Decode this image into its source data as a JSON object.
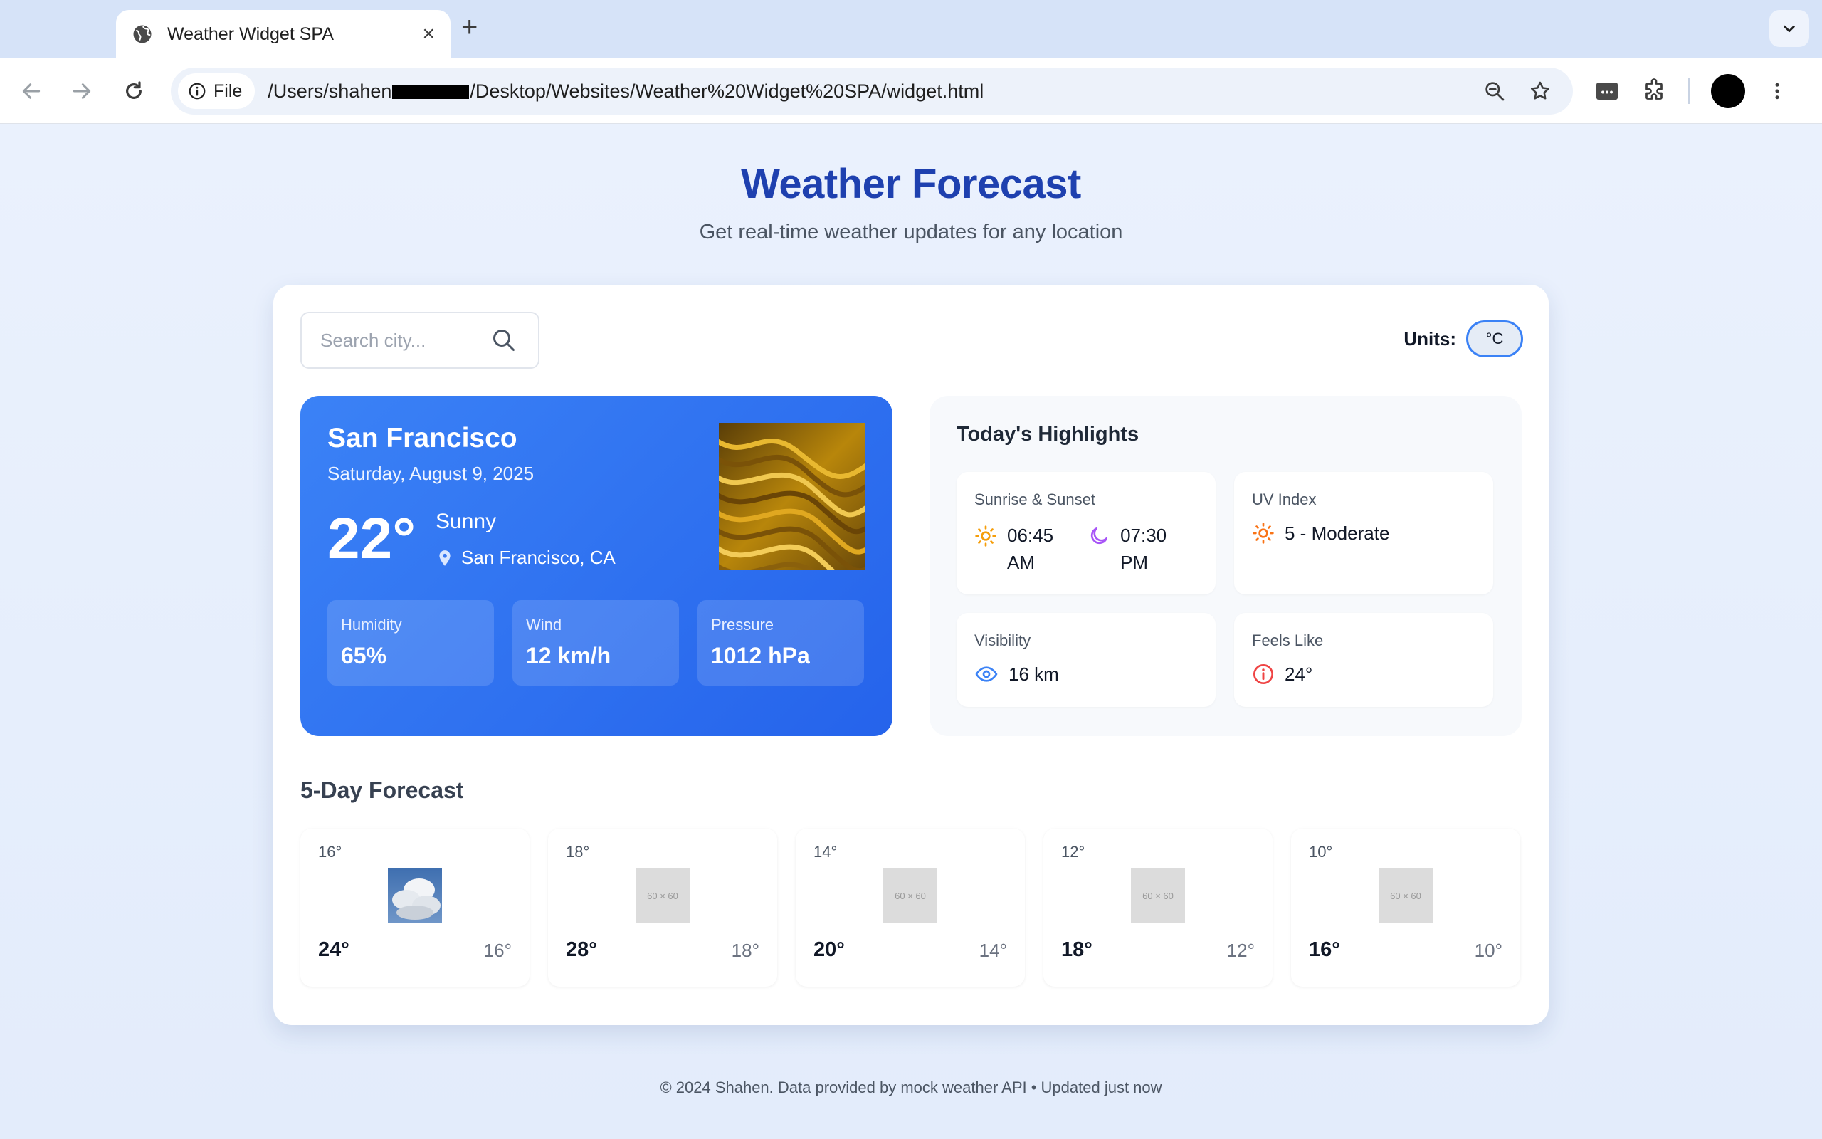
{
  "browser": {
    "tab_title": "Weather Widget SPA",
    "new_tab": "+",
    "close": "×",
    "file_chip": "File",
    "url_prefix": "/Users/shahen",
    "url_suffix": "/Desktop/Websites/Weather%20Widget%20SPA/widget.html"
  },
  "header": {
    "title": "Weather Forecast",
    "subtitle": "Get real-time weather updates for any location"
  },
  "search": {
    "placeholder": "Search city..."
  },
  "units": {
    "label": "Units:",
    "value": "°C"
  },
  "current": {
    "city": "San Francisco",
    "date": "Saturday, August 9, 2025",
    "temp": "22°",
    "condition": "Sunny",
    "location": "San Francisco, CA",
    "stats": [
      {
        "label": "Humidity",
        "value": "65%"
      },
      {
        "label": "Wind",
        "value": "12 km/h"
      },
      {
        "label": "Pressure",
        "value": "1012 hPa"
      }
    ]
  },
  "highlights": {
    "title": "Today's Highlights",
    "sunrise_sunset": {
      "label": "Sunrise & Sunset",
      "sunrise": "06:45",
      "sunrise_period": "AM",
      "sunset": "07:30",
      "sunset_period": "PM"
    },
    "uv": {
      "label": "UV Index",
      "value": "5 - Moderate"
    },
    "visibility": {
      "label": "Visibility",
      "value": "16 km"
    },
    "feels_like": {
      "label": "Feels Like",
      "value": "24°"
    }
  },
  "forecast": {
    "title": "5-Day Forecast",
    "days": [
      {
        "top": "16°",
        "high": "24°",
        "low": "16°",
        "image": "cloudy-sky"
      },
      {
        "top": "18°",
        "high": "28°",
        "low": "18°",
        "image": "placeholder",
        "placeholder_text": "60 × 60"
      },
      {
        "top": "14°",
        "high": "20°",
        "low": "14°",
        "image": "placeholder",
        "placeholder_text": "60 × 60"
      },
      {
        "top": "12°",
        "high": "18°",
        "low": "12°",
        "image": "placeholder",
        "placeholder_text": "60 × 60"
      },
      {
        "top": "10°",
        "high": "16°",
        "low": "10°",
        "image": "placeholder",
        "placeholder_text": "60 × 60"
      }
    ]
  },
  "footer": {
    "text": "© 2024 Shahen. Data provided by mock weather API • Updated just now"
  },
  "colors": {
    "accent": "#3b82f6",
    "title": "#1e40af",
    "sun": "#f59e0b",
    "moon": "#a855f7",
    "eye": "#3b82f6",
    "alert": "#ef4444"
  }
}
